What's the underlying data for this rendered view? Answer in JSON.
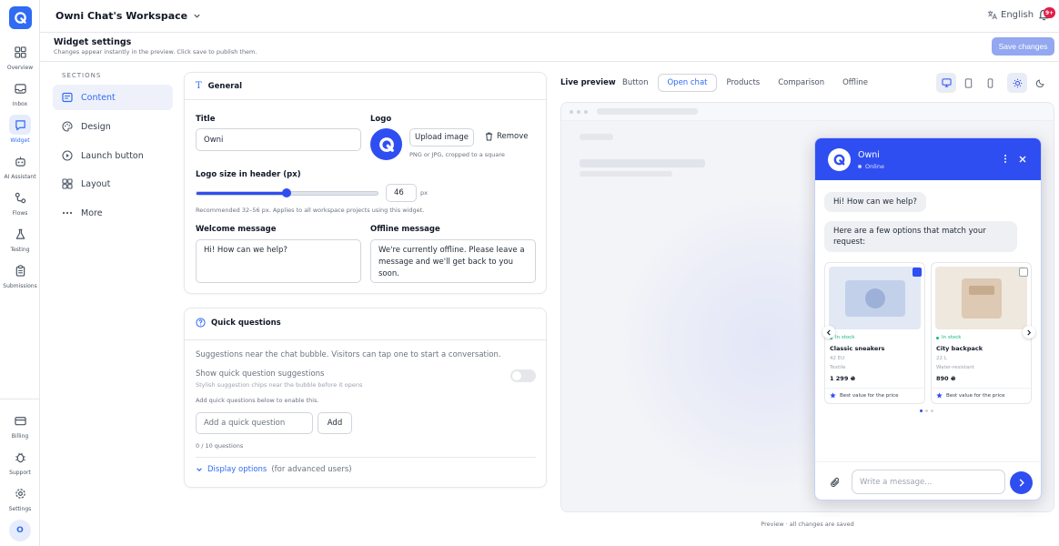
{
  "app": {
    "workspace_name": "Owni Chat's Workspace",
    "language": "English",
    "notification_count": "9+"
  },
  "nav": [
    {
      "label": "Overview",
      "icon": "grid-icon",
      "active": false
    },
    {
      "label": "Inbox",
      "icon": "inbox-icon",
      "active": false
    },
    {
      "label": "Widget",
      "icon": "chat-bubble-icon",
      "active": true
    },
    {
      "label": "AI Assistant",
      "icon": "robot-icon",
      "active": false
    },
    {
      "label": "Flows",
      "icon": "flow-icon",
      "active": false
    },
    {
      "label": "Testing",
      "icon": "flask-icon",
      "active": false
    },
    {
      "label": "Submissions",
      "icon": "clipboard-icon",
      "active": false
    }
  ],
  "nav_bottom": [
    {
      "label": "Billing",
      "icon": "card-icon"
    },
    {
      "label": "Support",
      "icon": "bug-icon"
    },
    {
      "label": "Settings",
      "icon": "gear-icon"
    }
  ],
  "user_avatar": "O",
  "header": {
    "title": "Widget settings",
    "subtitle": "Changes appear instantly in the preview. Click save to publish them.",
    "save_label": "Save changes"
  },
  "sections": {
    "heading": "SECTIONS",
    "items": [
      {
        "label": "Content",
        "active": true
      },
      {
        "label": "Design",
        "active": false
      },
      {
        "label": "Launch button",
        "active": false
      },
      {
        "label": "Layout",
        "active": false
      },
      {
        "label": "More",
        "active": false
      }
    ]
  },
  "general": {
    "heading": "General",
    "title_label": "Title",
    "title_value": "Owni",
    "logo_label": "Logo",
    "upload_label": "Upload image",
    "remove_label": "Remove",
    "logo_hint": "PNG or JPG, cropped to a square",
    "logo_size_label": "Logo size in header (px)",
    "logo_size_value": "46",
    "logo_size_unit": "px",
    "logo_size_fraction": 0.5,
    "logo_size_hint": "Recommended 32–56 px. Applies to all workspace projects using this widget.",
    "welcome_label": "Welcome message",
    "welcome_value": "Hi! How can we help?",
    "offline_label": "Offline message",
    "offline_value": "We're currently offline. Please leave a message and we'll get back to you soon."
  },
  "quick": {
    "heading": "Quick questions",
    "desc": "Suggestions near the chat bubble. Visitors can tap one to start a conversation.",
    "toggle_label": "Show quick question suggestions",
    "toggle_hint": "Stylish suggestion chips near the bubble before it opens",
    "toggle_on": false,
    "add_hint": "Add quick questions below to enable this.",
    "input_placeholder": "Add a quick question",
    "add_label": "Add",
    "count": "0 / 10 questions",
    "display_options": "Display options",
    "display_note": "(for advanced users)"
  },
  "preview": {
    "label": "Live preview",
    "tabs": [
      {
        "label": "Button",
        "active": false
      },
      {
        "label": "Open chat",
        "active": true
      },
      {
        "label": "Products",
        "active": false
      },
      {
        "label": "Comparison",
        "active": false
      },
      {
        "label": "Offline",
        "active": false
      }
    ],
    "footer": "Preview · all changes are saved"
  },
  "chat": {
    "name": "Owni",
    "status": "Online",
    "msg1": "Hi! How can we help?",
    "msg2": "Here are a few options that match your request:",
    "input_placeholder": "Write a message...",
    "products": [
      {
        "stock": "In stock",
        "name": "Classic sneakers",
        "meta1": "42 EU",
        "meta2": "Textile",
        "price": "1 299 ₴",
        "badge": "Best value for the price",
        "checked": true
      },
      {
        "stock": "In stock",
        "name": "City backpack",
        "meta1": "22 L",
        "meta2": "Water-resistant",
        "price": "890 ₴",
        "badge": "Best value for the price",
        "checked": false
      }
    ]
  },
  "colors": {
    "accent": "#2f4ef1",
    "brand": "#2f6bf3",
    "save_disabled": "#93a8f0",
    "badge": "#e11d48",
    "in_stock": "#10b981"
  }
}
